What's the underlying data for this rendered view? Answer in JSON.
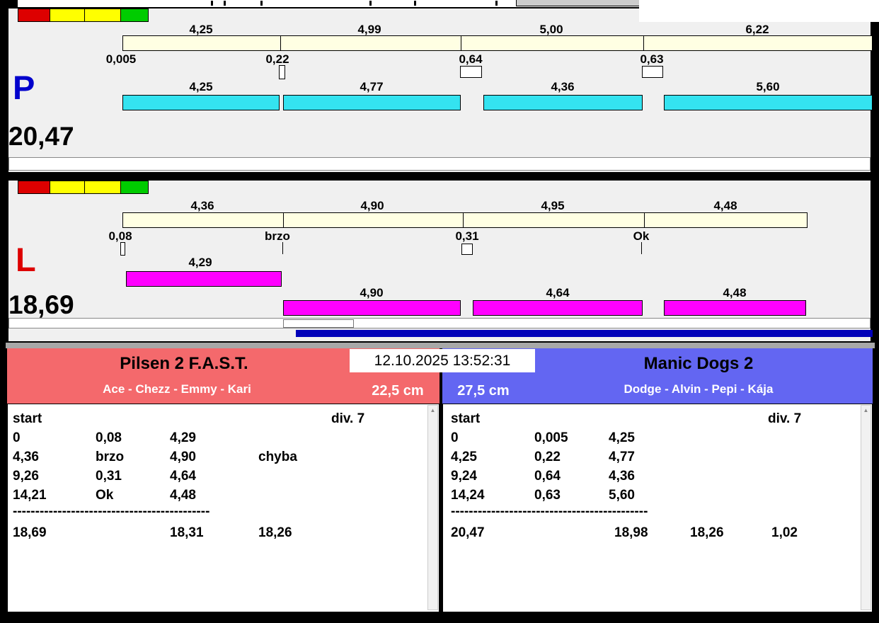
{
  "window": {
    "datetime": "12.10.2025 13:52:31"
  },
  "colors": {
    "cyan_bar": "#34E3F0",
    "magenta_bar": "#FF00FF",
    "split_bar": "#FFFFE3",
    "left_header": "#F4696C",
    "right_header": "#6366F2",
    "p_letter_color": "#0000CC",
    "l_letter_color": "#DD0000",
    "progress_bar": "#0000B8",
    "light_colors": [
      "#DD0000",
      "#FFFF00",
      "#FFFF00",
      "#00CC00"
    ]
  },
  "lane_p": {
    "letter": "P",
    "total": "20,47",
    "split_labels": [
      "4,25",
      "4,99",
      "5,00",
      "6,22"
    ],
    "cross_labels": [
      "0,005",
      "0,22",
      "0,64",
      "0,63"
    ],
    "run_labels": [
      "4,25",
      "4,77",
      "4,36",
      "5,60"
    ]
  },
  "lane_l": {
    "letter": "L",
    "total": "18,69",
    "split_labels": [
      "4,36",
      "4,90",
      "4,95",
      "4,48"
    ],
    "cross_labels": [
      "0,08",
      "brzo",
      "0,31",
      "Ok"
    ],
    "run_labels": [
      "4,29",
      "4,90",
      "4,64",
      "4,48"
    ]
  },
  "left_team": {
    "name": "Pilsen 2 F.A.S.T.",
    "dogs": "Ace - Chezz - Emmy - Kari",
    "jump_height": "22,5 cm",
    "start_label": "start",
    "division": "div. 7",
    "rows": [
      [
        "0",
        "0,08",
        "4,29",
        ""
      ],
      [
        "4,36",
        "brzo",
        "4,90",
        "chyba"
      ],
      [
        "9,26",
        "0,31",
        "4,64",
        ""
      ],
      [
        "14,21",
        "Ok",
        "4,48",
        ""
      ]
    ],
    "separator": "--------------------------------------------",
    "totals": [
      "18,69",
      "18,31",
      "18,26"
    ]
  },
  "right_team": {
    "name": "Manic Dogs 2",
    "dogs": "Dodge - Alvin - Pepi - Kája",
    "jump_height": "27,5 cm",
    "start_label": "start",
    "division": "div. 7",
    "rows": [
      [
        "0",
        "0,005",
        "4,25",
        ""
      ],
      [
        "4,25",
        "0,22",
        "4,77",
        ""
      ],
      [
        "9,24",
        "0,64",
        "4,36",
        ""
      ],
      [
        "14,24",
        "0,63",
        "5,60",
        ""
      ]
    ],
    "separator": "--------------------------------------------",
    "totals": [
      "20,47",
      "18,98",
      "18,26",
      "1,02"
    ]
  }
}
